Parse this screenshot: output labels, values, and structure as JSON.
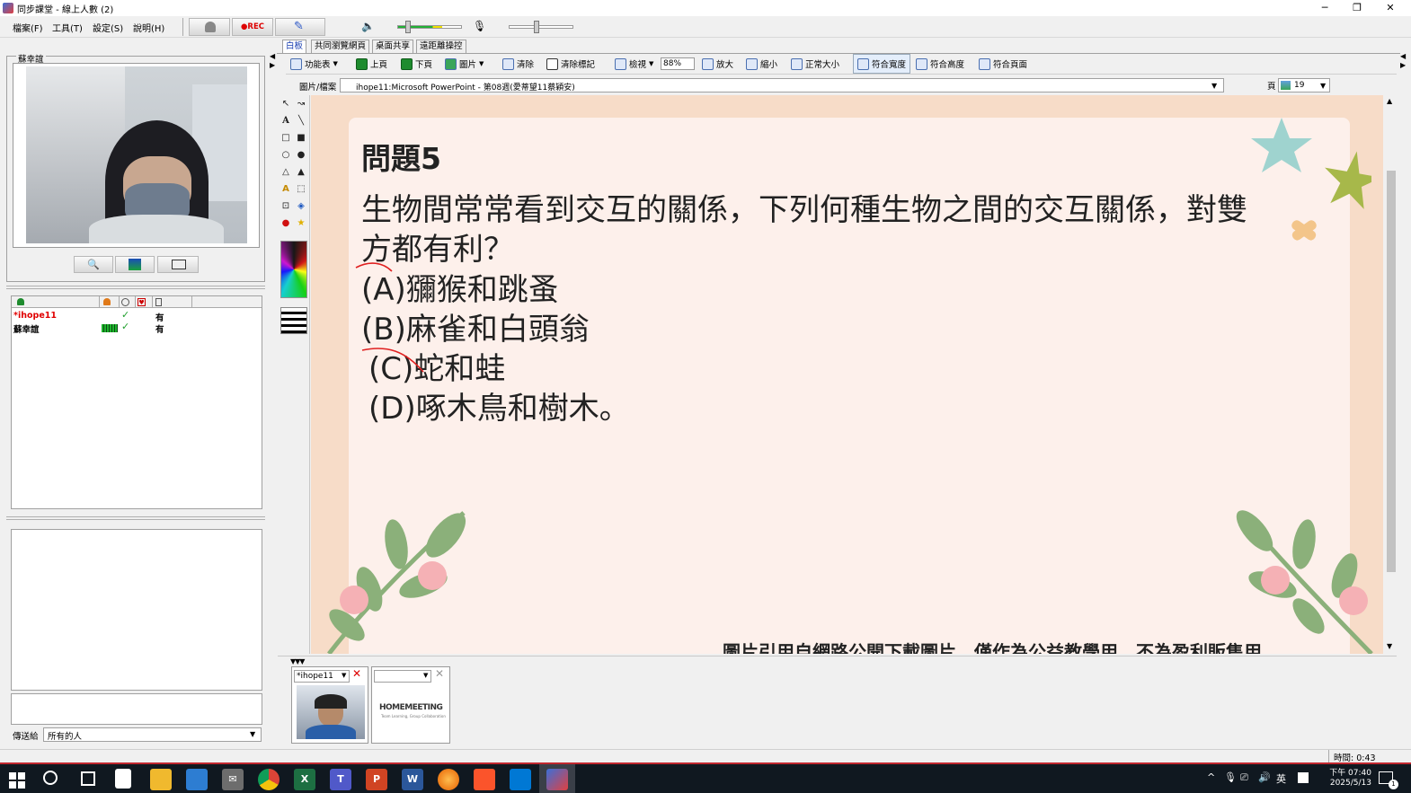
{
  "window": {
    "title": "同步課堂 - 線上人數 (2)",
    "minimize": "─",
    "restore": "❐",
    "close": "✕"
  },
  "menu": {
    "items": [
      "檔案(F)",
      "工具(T)",
      "設定(S)",
      "說明(H)"
    ],
    "rec_label": "●REC"
  },
  "left_panel": {
    "video_name": "蘇幸誼",
    "user_rows": [
      {
        "name": "*ihope11",
        "has": "有",
        "color": "#e00000"
      },
      {
        "name": "蘇幸誼",
        "has": "有",
        "color": "#000000"
      }
    ],
    "send_to_label": "傳送給",
    "send_to_value": "所有的人"
  },
  "tabs": [
    "白板",
    "共同瀏覽網頁",
    "桌面共享",
    "遠距離操控"
  ],
  "toolbar": {
    "items": [
      "功能表",
      "上頁",
      "下頁",
      "圖片",
      "清除",
      "清除標記",
      "檢視",
      "放大",
      "縮小",
      "正常大小",
      "符合寬度",
      "符合高度",
      "符合頁面"
    ],
    "zoom_value": "88%"
  },
  "file_row": {
    "label": "圖片/檔案",
    "value": "ihope11:Microsoft PowerPoint - 第08週(愛蒂望11蔡穎安)",
    "page_label": "頁",
    "page_value": "19"
  },
  "slide": {
    "title": "問題5",
    "question_line1": "生物間常常看到交互的關係，下列何種生物之間的交互關係，對雙",
    "question_line2": "方都有利？",
    "option_a": "(A)獼猴和跳蚤",
    "option_b": "(B)麻雀和白頭翁",
    "option_c": "(C)蛇和蛙",
    "option_d": "(D)啄木鳥和樹木。",
    "footer": "圖片引用自網路公開下載圖片，僅作為公益教學用，不為盈利販售用"
  },
  "thumbnails": {
    "user1": "*ihope11",
    "meeting_logo": "HOMEMEETING",
    "meeting_tagline": "Team Learning, Group Collaboration"
  },
  "status": {
    "time_label": "時間: 0:43"
  },
  "taskbar": {
    "clock_time": "下午 07:40",
    "clock_date": "2025/5/13",
    "ime": "英",
    "notify_count": "1"
  },
  "colors": {
    "accent_red": "#c0282f",
    "slide_bg": "#f7dcc8",
    "card_bg": "#fdf0eb"
  }
}
